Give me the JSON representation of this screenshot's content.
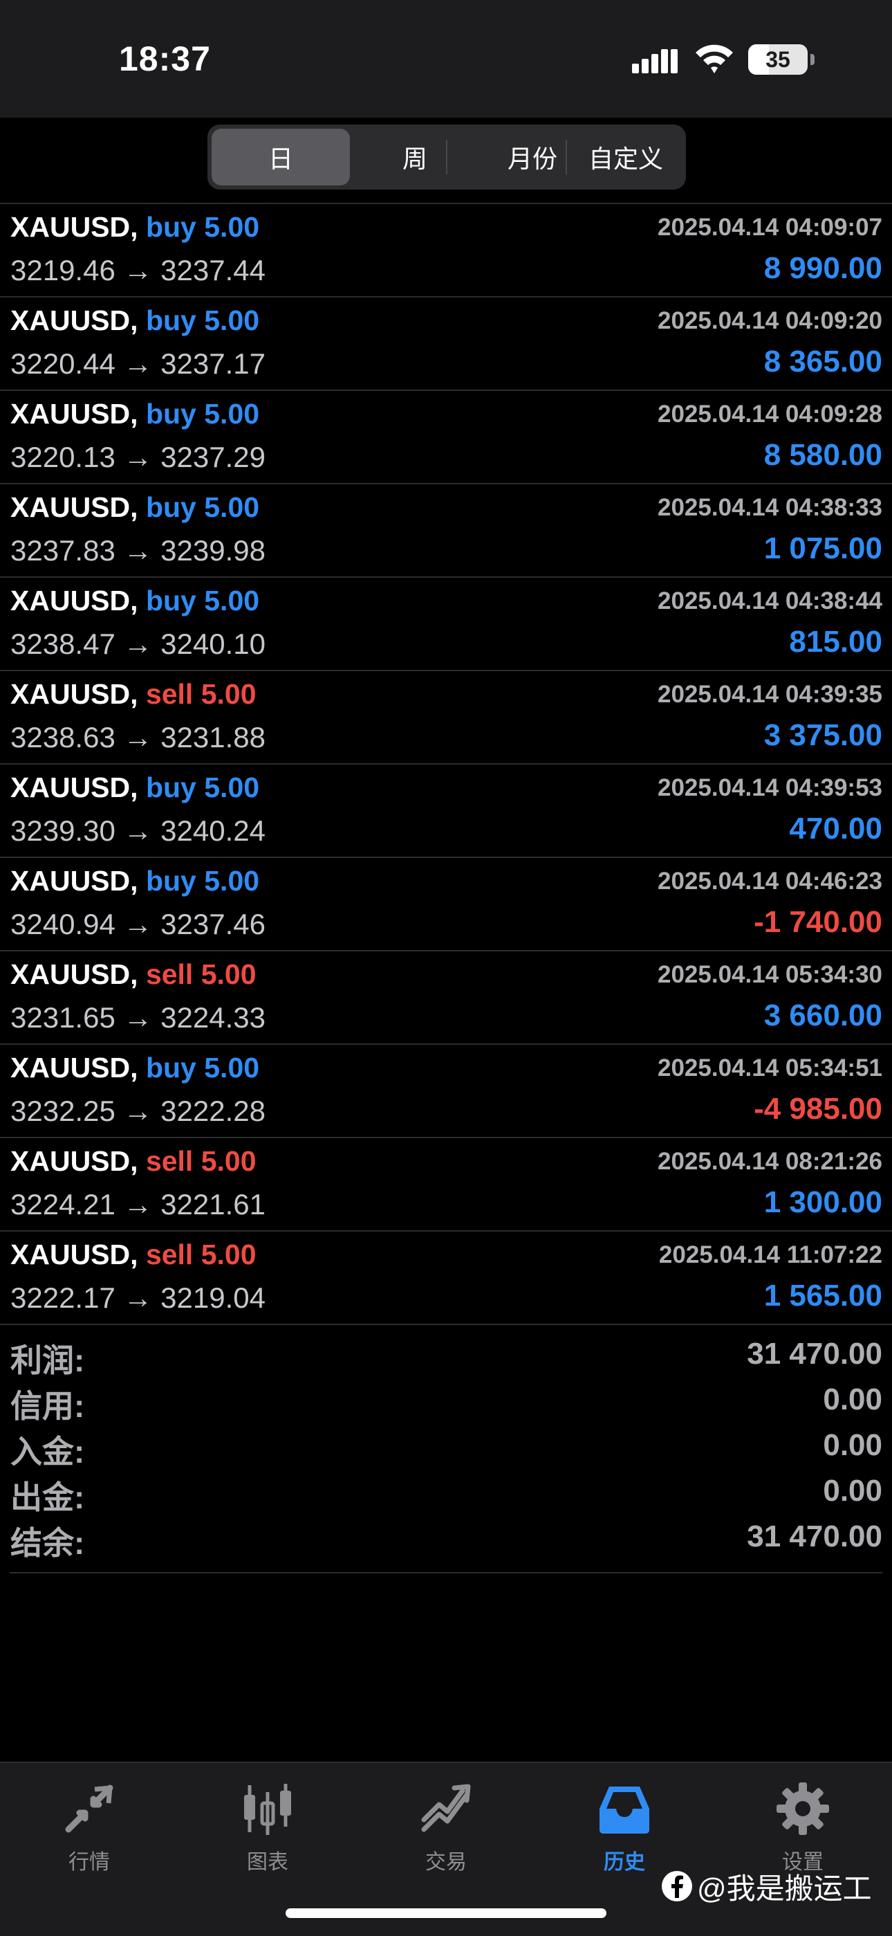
{
  "status_bar": {
    "time": "18:37",
    "battery_level": "35",
    "battery_percent": 35
  },
  "segmented": {
    "tabs": [
      "日",
      "周",
      "月份",
      "自定义"
    ],
    "selected": "日"
  },
  "deals": [
    {
      "symbol": "XAUUSD,",
      "side": "buy",
      "volume": "5.00",
      "datetime": "2025.04.14 04:09:07",
      "open_price": "3219.46",
      "arrow": "→",
      "close_price": "3237.44",
      "profit": "8 990.00"
    },
    {
      "symbol": "XAUUSD,",
      "side": "buy",
      "volume": "5.00",
      "datetime": "2025.04.14 04:09:20",
      "open_price": "3220.44",
      "arrow": "→",
      "close_price": "3237.17",
      "profit": "8 365.00"
    },
    {
      "symbol": "XAUUSD,",
      "side": "buy",
      "volume": "5.00",
      "datetime": "2025.04.14 04:09:28",
      "open_price": "3220.13",
      "arrow": "→",
      "close_price": "3237.29",
      "profit": "8 580.00"
    },
    {
      "symbol": "XAUUSD,",
      "side": "buy",
      "volume": "5.00",
      "datetime": "2025.04.14 04:38:33",
      "open_price": "3237.83",
      "arrow": "→",
      "close_price": "3239.98",
      "profit": "1 075.00"
    },
    {
      "symbol": "XAUUSD,",
      "side": "buy",
      "volume": "5.00",
      "datetime": "2025.04.14 04:38:44",
      "open_price": "3238.47",
      "arrow": "→",
      "close_price": "3240.10",
      "profit": "815.00"
    },
    {
      "symbol": "XAUUSD,",
      "side": "sell",
      "volume": "5.00",
      "datetime": "2025.04.14 04:39:35",
      "open_price": "3238.63",
      "arrow": "→",
      "close_price": "3231.88",
      "profit": "3 375.00"
    },
    {
      "symbol": "XAUUSD,",
      "side": "buy",
      "volume": "5.00",
      "datetime": "2025.04.14 04:39:53",
      "open_price": "3239.30",
      "arrow": "→",
      "close_price": "3240.24",
      "profit": "470.00"
    },
    {
      "symbol": "XAUUSD,",
      "side": "buy",
      "volume": "5.00",
      "datetime": "2025.04.14 04:46:23",
      "open_price": "3240.94",
      "arrow": "→",
      "close_price": "3237.46",
      "profit": "-1 740.00"
    },
    {
      "symbol": "XAUUSD,",
      "side": "sell",
      "volume": "5.00",
      "datetime": "2025.04.14 05:34:30",
      "open_price": "3231.65",
      "arrow": "→",
      "close_price": "3224.33",
      "profit": "3 660.00"
    },
    {
      "symbol": "XAUUSD,",
      "side": "buy",
      "volume": "5.00",
      "datetime": "2025.04.14 05:34:51",
      "open_price": "3232.25",
      "arrow": "→",
      "close_price": "3222.28",
      "profit": "-4 985.00"
    },
    {
      "symbol": "XAUUSD,",
      "side": "sell",
      "volume": "5.00",
      "datetime": "2025.04.14 08:21:26",
      "open_price": "3224.21",
      "arrow": "→",
      "close_price": "3221.61",
      "profit": "1 300.00"
    },
    {
      "symbol": "XAUUSD,",
      "side": "sell",
      "volume": "5.00",
      "datetime": "2025.04.14 11:07:22",
      "open_price": "3222.17",
      "arrow": "→",
      "close_price": "3219.04",
      "profit": "1 565.00"
    }
  ],
  "summary": [
    {
      "label": "利润:",
      "value": "31 470.00"
    },
    {
      "label": "信用:",
      "value": "0.00"
    },
    {
      "label": "入金:",
      "value": "0.00"
    },
    {
      "label": "出金:",
      "value": "0.00"
    },
    {
      "label": "结余:",
      "value": "31 470.00"
    }
  ],
  "tabbar": [
    {
      "label": "行情",
      "icon": "quotes-arrows-icon",
      "active": false
    },
    {
      "label": "图表",
      "icon": "candlestick-chart-icon",
      "active": false
    },
    {
      "label": "交易",
      "icon": "trade-trend-icon",
      "active": false
    },
    {
      "label": "历史",
      "icon": "history-inbox-icon",
      "active": true
    },
    {
      "label": "设置",
      "icon": "gear-icon",
      "active": false
    }
  ],
  "watermark": {
    "text": "@我是搬运工",
    "icon": "facebook-logo-icon"
  },
  "colors": {
    "buy": "#2f8cf5",
    "sell": "#ef4b43",
    "accent": "#2f8cf5",
    "background": "#000000"
  }
}
